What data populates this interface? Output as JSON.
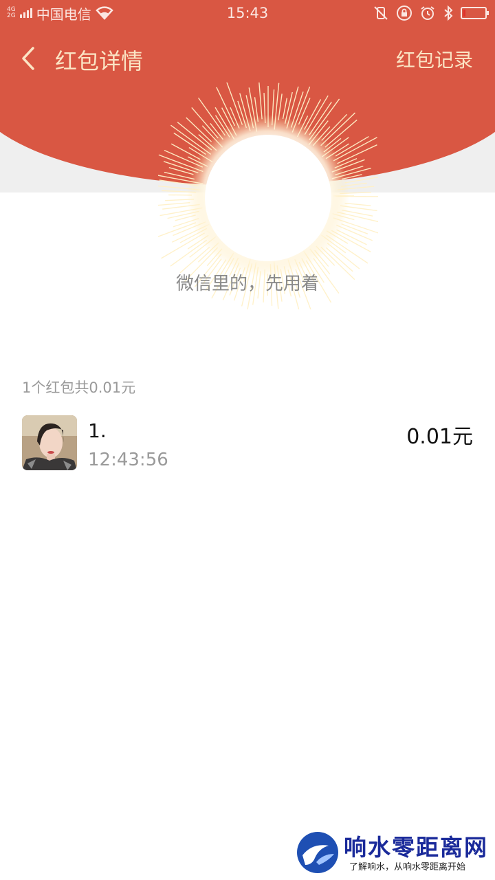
{
  "status_bar": {
    "net_top": "4G",
    "net_bottom": "2G",
    "carrier": "中国电信",
    "time": "15:43"
  },
  "nav": {
    "title": "红包详情",
    "record_link": "红包记录"
  },
  "slogan": "微信里的，先用着",
  "summary": "1个红包共0.01元",
  "records": [
    {
      "name": "1.",
      "time": "12:43:56",
      "amount": "0.01元"
    }
  ],
  "watermark": {
    "title": "响水零距离网",
    "subtitle": "了解响水，从响水零距离开始"
  },
  "colors": {
    "header_red": "#d95743",
    "nav_text": "#fbe4c4",
    "page_bg": "#ffffff",
    "upper_bg": "#efefef"
  },
  "battery": {
    "level_percent": 10
  }
}
